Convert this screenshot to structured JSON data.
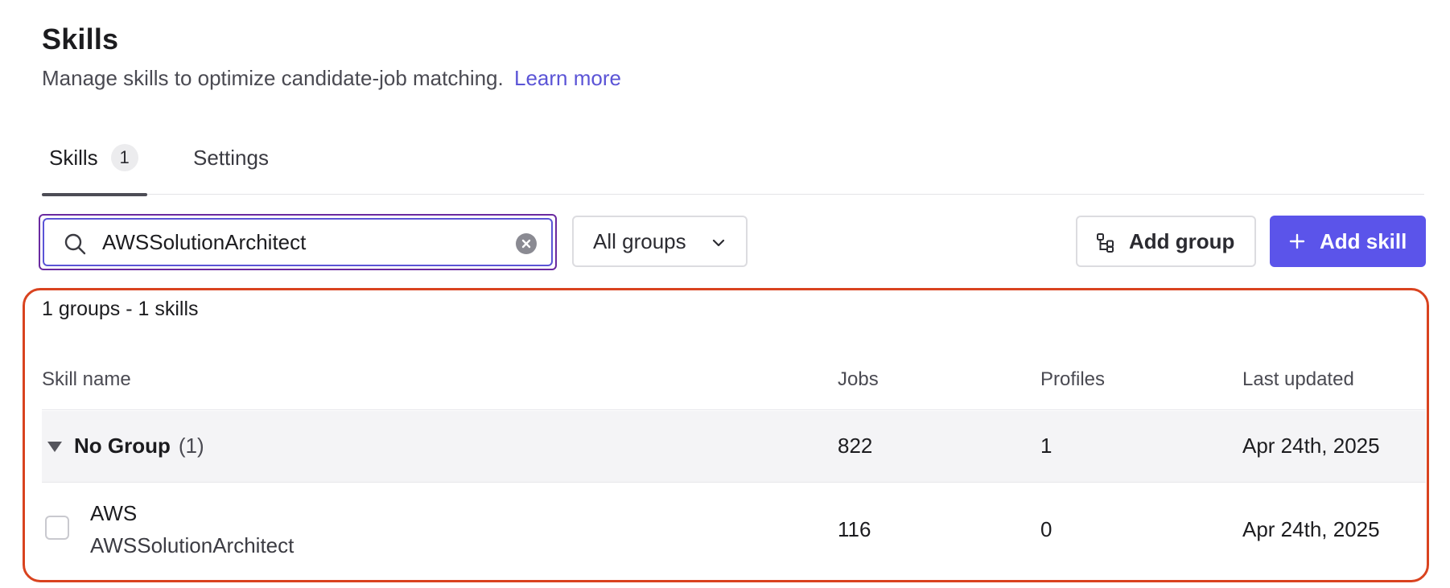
{
  "header": {
    "title": "Skills",
    "subtitle": "Manage skills to optimize candidate-job matching.",
    "learn_more": "Learn more"
  },
  "tabs": [
    {
      "label": "Skills",
      "count": "1",
      "active": true
    },
    {
      "label": "Settings",
      "active": false
    }
  ],
  "toolbar": {
    "search_value": "AWSSolutionArchitect",
    "group_filter": "All groups",
    "add_group_label": "Add group",
    "add_skill_label": "Add skill"
  },
  "results": {
    "summary": "1 groups - 1 skills",
    "columns": [
      "Skill name",
      "Jobs",
      "Profiles",
      "Last updated"
    ],
    "group": {
      "name": "No Group",
      "count": "(1)",
      "jobs": "822",
      "profiles": "1",
      "last_updated": "Apr 24th, 2025"
    },
    "skill": {
      "name": "AWS",
      "alias": "AWSSolutionArchitect",
      "jobs": "116",
      "profiles": "0",
      "last_updated": "Apr 24th, 2025"
    }
  },
  "colors": {
    "accent": "#5b54ea",
    "link": "#5b54d6",
    "highlight_border": "#d9431f",
    "focus_outline": "#6a2aa0"
  }
}
